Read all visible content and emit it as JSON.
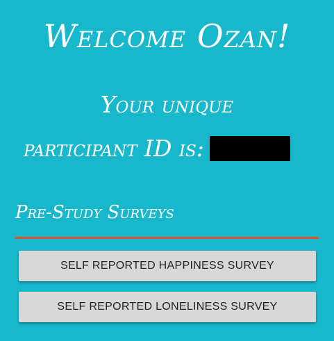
{
  "welcome": {
    "title": "Welcome Ozan!"
  },
  "participant": {
    "line1": "Your unique",
    "line2_prefix": "participant ID is:",
    "id_value_redacted": true
  },
  "section": {
    "title": "Pre-Study Surveys",
    "divider_color": "#e0512b"
  },
  "surveys": [
    {
      "label": "SELF REPORTED HAPPINESS SURVEY"
    },
    {
      "label": "SELF REPORTED LONELINESS SURVEY"
    }
  ],
  "colors": {
    "background": "#17b7cc",
    "text": "#ffffff",
    "button_bg": "#d8d8d8",
    "button_text": "#222222",
    "redaction": "#000000"
  }
}
